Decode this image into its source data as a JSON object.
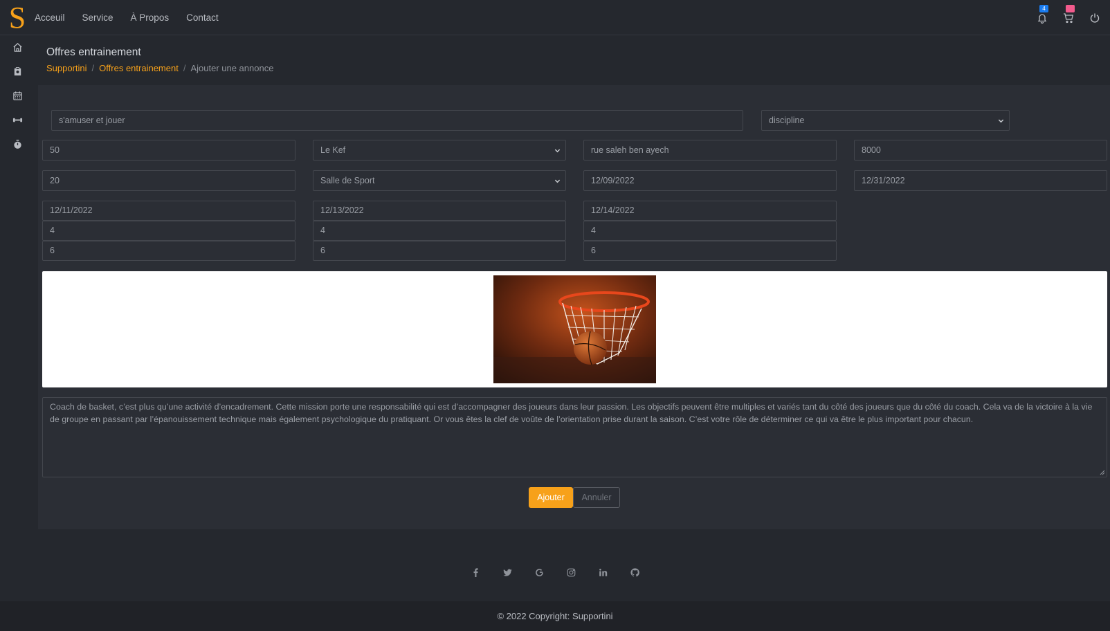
{
  "brand": {
    "logo_letter": "S",
    "color": "#f7a11a"
  },
  "nav": {
    "items": [
      {
        "label": "Acceuil"
      },
      {
        "label": "Service"
      },
      {
        "label": "À Propos"
      },
      {
        "label": "Contact"
      }
    ]
  },
  "topbar": {
    "notifications_badge": "4",
    "icons": [
      "bell-icon",
      "cart-icon",
      "power-icon"
    ]
  },
  "sidebar": {
    "icons": [
      "home-icon",
      "clipboard-icon",
      "calendar-icon",
      "dumbbell-icon",
      "stopwatch-icon"
    ]
  },
  "header": {
    "title": "Offres entrainement",
    "breadcrumb": [
      {
        "label": "Supportini"
      },
      {
        "label": "Offres entrainement"
      },
      {
        "label": "Ajouter une annonce"
      }
    ],
    "separator": "/"
  },
  "form": {
    "title": "s'amuser et jouer",
    "discipline": "discipline",
    "row1": {
      "price": "50",
      "city": "Le Kef",
      "address": "rue saleh ben ayech",
      "postal_code": "8000"
    },
    "row2": {
      "places": "20",
      "venue_type": "Salle de Sport",
      "start_date": "12/09/2022",
      "end_date": "12/31/2022"
    },
    "sessions": [
      {
        "date": "12/11/2022",
        "start": "4",
        "end": "6"
      },
      {
        "date": "12/13/2022",
        "start": "4",
        "end": "6"
      },
      {
        "date": "12/14/2022",
        "start": "4",
        "end": "6"
      }
    ],
    "description": "Coach de basket, c’est plus qu’une activité d’encadrement. Cette mission porte une responsabilité qui est d’accompagner des joueurs dans leur passion. Les objectifs peuvent être multiples et variés tant du côté des joueurs que du côté du coach. Cela va de la victoire à la vie de groupe en passant par l’épanouissement technique mais également psychologique du pratiquant. Or vous êtes la clef de voûte de l’orientation prise durant la saison. C’est votre rôle de déterminer ce qui va être le plus important pour chacun.",
    "add_label": "Ajouter",
    "cancel_label": "Annuler"
  },
  "socials": [
    "facebook-icon",
    "twitter-icon",
    "google-icon",
    "instagram-icon",
    "linkedin-icon",
    "github-icon"
  ],
  "footer": {
    "copyright": "© 2022 Copyright: Supportini"
  },
  "colors": {
    "accent": "#f7a11a",
    "badge_blue": "#1a7cf0",
    "badge_pink": "#f25a8c",
    "background": "#25282e",
    "panel": "#2b2e35"
  }
}
